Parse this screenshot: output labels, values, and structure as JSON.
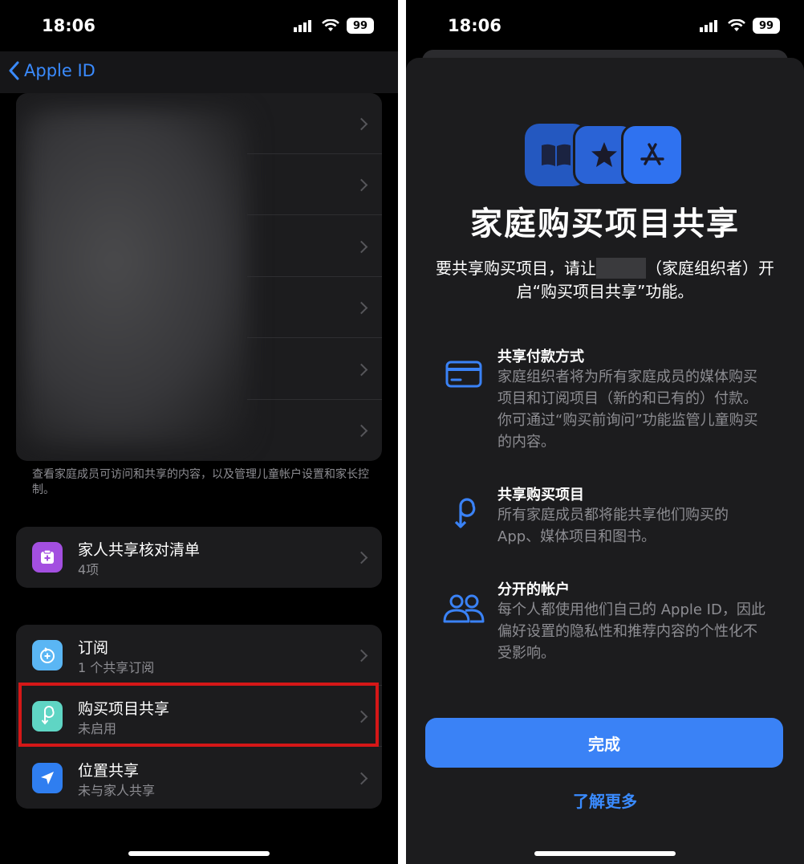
{
  "status_bar": {
    "time": "18:06",
    "battery": "99"
  },
  "left": {
    "nav": {
      "back_label": "Apple ID"
    },
    "footer_note": "查看家庭成员可访问和共享的内容，以及管理儿童帐户设置和家长控制。",
    "checklist": {
      "title": "家人共享核对清单",
      "subtitle": "4项",
      "icon": "checklist-icon",
      "icon_color": "#a34fe0"
    },
    "sharing_items": [
      {
        "title": "订阅",
        "subtitle": "1 个共享订阅",
        "icon": "subscriptions-icon",
        "icon_color": "#5ab6f4"
      },
      {
        "title": "购买项目共享",
        "subtitle": "未启用",
        "icon": "purchase-sharing-icon",
        "icon_color": "#5fd5c4"
      },
      {
        "title": "位置共享",
        "subtitle": "未与家人共享",
        "icon": "location-arrow-icon",
        "icon_color": "#2f7ef0"
      }
    ]
  },
  "right": {
    "title": "家庭购买项目共享",
    "description_part1": "要共享购买项目，请让",
    "description_part2": "（家庭组织者）开启“购买项目共享”功能。",
    "features": [
      {
        "icon": "credit-card-icon",
        "title": "共享付款方式",
        "description": "家庭组织者将为所有家庭成员的媒体购买项目和订阅项目（新的和已有的）付款。你可通过“购买前询问”功能监管儿童购买的内容。"
      },
      {
        "icon": "purchase-sharing-icon",
        "title": "共享购买项目",
        "description": "所有家庭成员都将能共享他们购买的App、媒体项目和图书。"
      },
      {
        "icon": "people-icon",
        "title": "分开的帐户",
        "description": "每个人都使用他们自己的 Apple ID，因此偏好设置的隐私性和推荐内容的个性化不受影响。"
      }
    ],
    "done_label": "完成",
    "learn_more_label": "了解更多",
    "accent_color": "#3a82f6"
  }
}
